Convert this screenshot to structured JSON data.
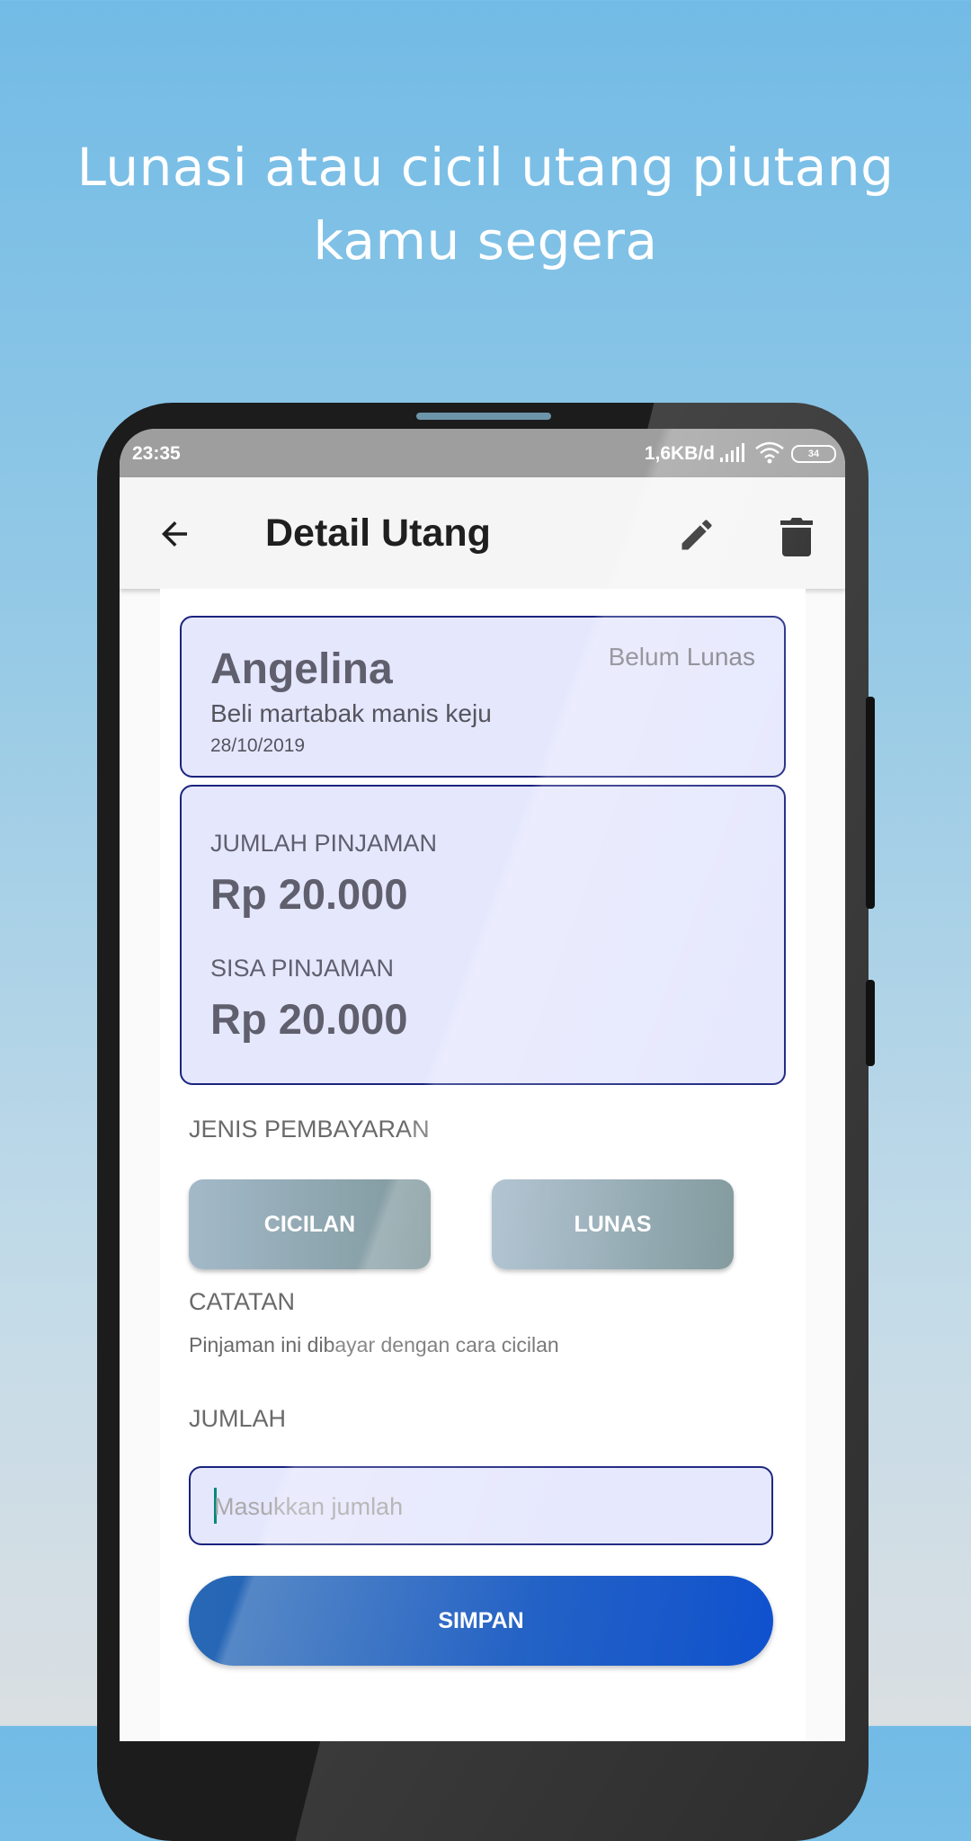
{
  "promo": {
    "headline_line1": "Lunasi atau cicil utang piutang",
    "headline_line2": "kamu segera"
  },
  "status_bar": {
    "time": "23:35",
    "network_speed": "1,6KB/d",
    "battery": "34"
  },
  "app_bar": {
    "title": "Detail Utang",
    "icons": [
      "back-arrow-icon",
      "pencil-edit-icon",
      "trash-delete-icon"
    ]
  },
  "debt": {
    "name": "Angelina",
    "status": "Belum Lunas",
    "description": "Beli martabak manis keju",
    "date": "28/10/2019"
  },
  "amounts": {
    "loan_label": "JUMLAH PINJAMAN",
    "loan_value": "Rp 20.000",
    "remaining_label": "SISA PINJAMAN",
    "remaining_value": "Rp 20.000"
  },
  "payment": {
    "section_label": "JENIS PEMBAYARAN",
    "installment_label": "CICILAN",
    "full_label": "LUNAS"
  },
  "note": {
    "label": "CATATAN",
    "text": "Pinjaman ini dibayar dengan cara cicilan"
  },
  "amount_input": {
    "label": "JUMLAH",
    "placeholder": "Masukkan jumlah",
    "value": ""
  },
  "save_label": "SIMPAN",
  "colors": {
    "card_bg": "#e5e7fd",
    "card_border": "#1a237e",
    "save_button": "#1a5bc4",
    "payment_button": "#92aab4"
  }
}
